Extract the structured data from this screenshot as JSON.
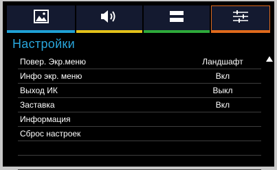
{
  "colors": {
    "accent_title": "#29a6dc",
    "tab_picture": "#1fa1d5",
    "tab_audio": "#e3c21a",
    "tab_input": "#2eaa3a",
    "tab_setup": "#e06a1c"
  },
  "tabs": [
    {
      "icon": "picture-icon",
      "selected": false
    },
    {
      "icon": "speaker-icon",
      "selected": false
    },
    {
      "icon": "input-icon",
      "selected": false
    },
    {
      "icon": "sliders-icon",
      "selected": true
    }
  ],
  "menu": {
    "title": "Настройки",
    "items": [
      {
        "label": "Повер. Экр.меню",
        "value": "Ландшафт"
      },
      {
        "label": "Инфо экр. меню",
        "value": "Вкл"
      },
      {
        "label": "Выход ИК",
        "value": "Выкл"
      },
      {
        "label": "Заставка",
        "value": "Вкл"
      },
      {
        "label": "Информация",
        "value": ""
      },
      {
        "label": "Сброс настроек",
        "value": ""
      },
      {
        "label": "",
        "value": ""
      },
      {
        "label": "",
        "value": ""
      }
    ]
  }
}
